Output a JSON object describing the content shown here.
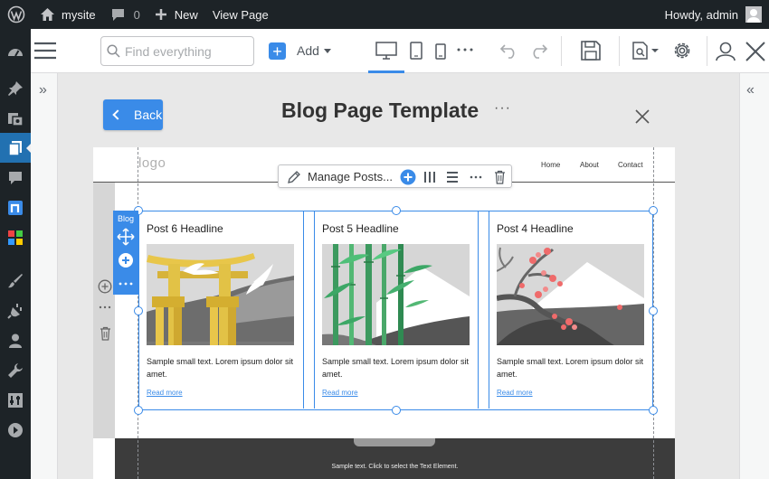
{
  "adminbar": {
    "site_name": "mysite",
    "comments_count": "0",
    "new_label": "New",
    "view_label": "View Page",
    "greeting": "Howdy, admin"
  },
  "toolbar": {
    "search_placeholder": "Find everything",
    "add_label": "Add"
  },
  "editor": {
    "back_label": "Back",
    "title": "Blog Page Template"
  },
  "page_header": {
    "logo": "logo",
    "nav": [
      "Home",
      "About",
      "Contact"
    ]
  },
  "blog": {
    "tab_label": "Blog",
    "manage_label": "Manage Posts...",
    "posts": [
      {
        "headline": "Post 6 Headline",
        "text": "Sample small text. Lorem ipsum dolor sit amet.",
        "link": "Read more"
      },
      {
        "headline": "Post 5 Headline",
        "text": "Sample small text. Lorem ipsum dolor sit amet.",
        "link": "Read more"
      },
      {
        "headline": "Post 4 Headline",
        "text": "Sample small text. Lorem ipsum dolor sit amet.",
        "link": "Read more"
      }
    ]
  },
  "footer": {
    "text": "Sample text. Click to select the Text Element."
  },
  "colors": {
    "wp_dark": "#1d2327",
    "accent": "#3a8be8",
    "wp_active": "#2271b1"
  }
}
